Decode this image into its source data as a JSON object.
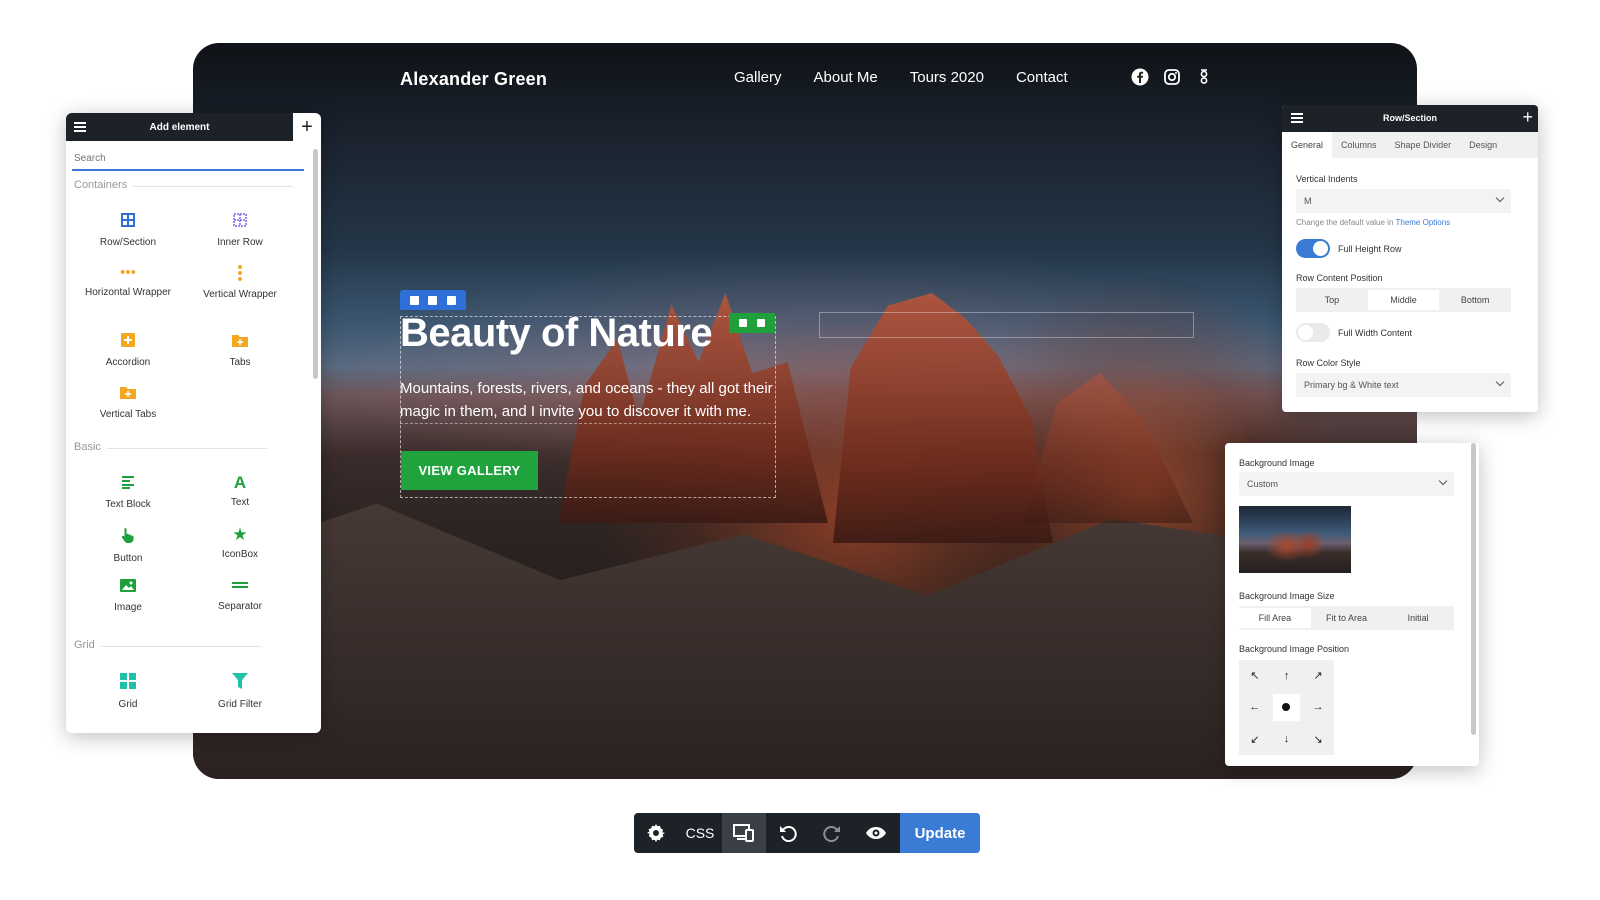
{
  "site": {
    "logo": "Alexander Green",
    "nav": [
      "Gallery",
      "About Me",
      "Tours 2020",
      "Contact"
    ],
    "social_icons": [
      "facebook-icon",
      "instagram-icon",
      "tripadvisor-icon"
    ],
    "hero_title": "Beauty of Nature",
    "hero_text": "Mountains, forests, rivers, and oceans - they all got their magic in them, and I invite you to discover it with me.",
    "hero_button": "VIEW GALLERY"
  },
  "add_panel": {
    "title": "Add element",
    "search_placeholder": "Search",
    "sections": {
      "containers": "Containers",
      "basic": "Basic",
      "grid": "Grid"
    },
    "containers": [
      {
        "label": "Row/Section",
        "icon": "row-icon"
      },
      {
        "label": "Inner Row",
        "icon": "inner-row-icon"
      },
      {
        "label": "Horizontal Wrapper",
        "icon": "horizontal-dots-icon"
      },
      {
        "label": "Vertical Wrapper",
        "icon": "vertical-dots-icon"
      },
      {
        "label": "Accordion",
        "icon": "accordion-icon"
      },
      {
        "label": "Tabs",
        "icon": "tabs-icon"
      },
      {
        "label": "Vertical Tabs",
        "icon": "vertical-tabs-icon"
      }
    ],
    "basic": [
      {
        "label": "Text Block",
        "icon": "text-block-icon"
      },
      {
        "label": "Text",
        "icon": "text-icon"
      },
      {
        "label": "Button",
        "icon": "pointer-icon"
      },
      {
        "label": "IconBox",
        "icon": "star-icon"
      },
      {
        "label": "Image",
        "icon": "image-icon"
      },
      {
        "label": "Separator",
        "icon": "separator-icon"
      }
    ],
    "grid": [
      {
        "label": "Grid",
        "icon": "grid-icon"
      },
      {
        "label": "Grid Filter",
        "icon": "filter-icon"
      }
    ],
    "colors": {
      "containers": "#2f6fd8",
      "containers_alt": "#f5a623",
      "basic": "#1fa03b",
      "grid": "#1fc2a8"
    }
  },
  "row_panel": {
    "title": "Row/Section",
    "tabs": [
      "General",
      "Columns",
      "Shape Divider",
      "Design"
    ],
    "active_tab": "General",
    "vertical_indents_label": "Vertical Indents",
    "vertical_indents_value": "M",
    "hint_prefix": "Change the default value in",
    "hint_link": "Theme Options",
    "full_height_label": "Full Height Row",
    "full_height_on": true,
    "content_position_label": "Row Content Position",
    "content_position_options": [
      "Top",
      "Middle",
      "Bottom"
    ],
    "content_position_value": "Middle",
    "full_width_label": "Full Width Content",
    "full_width_on": false,
    "color_style_label": "Row Color Style",
    "color_style_value": "Primary bg & White text"
  },
  "bg_panel": {
    "bg_image_label": "Background Image",
    "bg_image_value": "Custom",
    "bg_size_label": "Background Image Size",
    "bg_size_options": [
      "Fill Area",
      "Fit to Area",
      "Initial"
    ],
    "bg_size_value": "Fill Area",
    "bg_position_label": "Background Image Position",
    "position_arrows": [
      "↖",
      "↑",
      "↗",
      "←",
      "",
      "→",
      "↙",
      "↓",
      "↘"
    ]
  },
  "toolbar": {
    "css_label": "CSS",
    "update_label": "Update",
    "icons": [
      "gear-icon",
      "responsive-icon",
      "undo-icon",
      "redo-icon",
      "eye-icon"
    ]
  },
  "accent": "#3a7bd5"
}
